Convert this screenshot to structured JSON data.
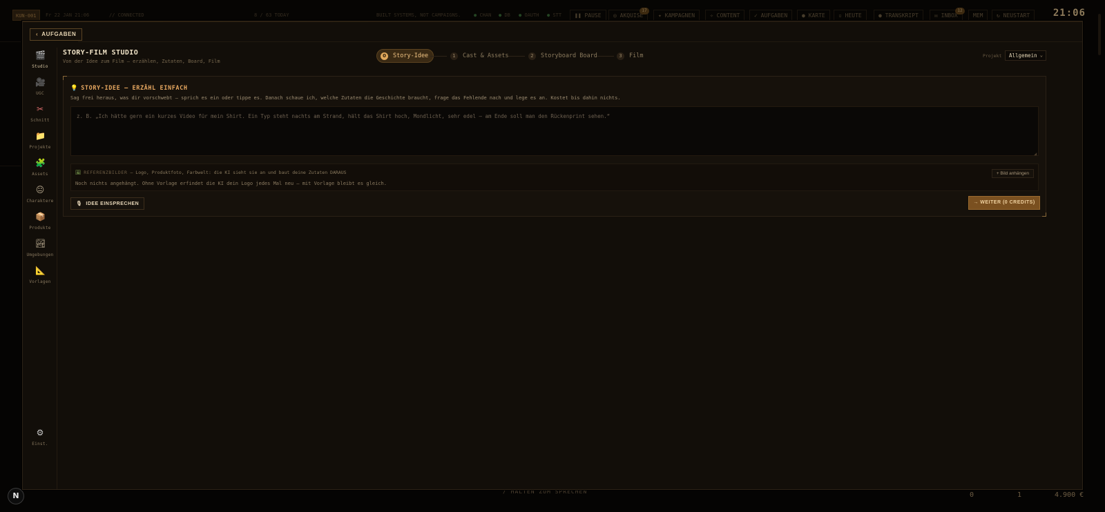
{
  "background": {
    "left_badge": "KUN-001",
    "topbar_left": "Fr 22 JAN 21:06",
    "topbar_connection": "// CONNECTED",
    "topbar_counter": "8 / 63 TODAY",
    "topbar_tagline": "BUILT SYSTEMS, NOT CAMPAIGNS.",
    "status_dots": [
      "CHAN",
      "DB",
      "OAUTH",
      "STT"
    ],
    "nav": [
      {
        "icon": "pause-icon",
        "glyph": "❚❚",
        "label": "PAUSE"
      },
      {
        "icon": "target-icon",
        "glyph": "◎",
        "label": "AKQUISE",
        "badge": "17"
      },
      {
        "icon": "spark-icon",
        "glyph": "✦",
        "label": "KAMPAGNEN"
      },
      {
        "icon": "diamond-icon",
        "glyph": "✧",
        "label": "CONTENT"
      },
      {
        "icon": "check-icon",
        "glyph": "✓",
        "label": "AUFGABEN"
      },
      {
        "icon": "globe-icon",
        "glyph": "●",
        "label": "KARTE"
      },
      {
        "icon": "calendar-icon",
        "glyph": "▫",
        "label": "HEUTE"
      },
      {
        "icon": "mic-icon",
        "glyph": "●",
        "label": "TRANSKRIPT"
      },
      {
        "icon": "mail-icon",
        "glyph": "✉",
        "label": "INBOX",
        "badge": "12"
      },
      {
        "icon": "memory-icon",
        "glyph": "",
        "label": "MEM"
      },
      {
        "icon": "restart-icon",
        "glyph": "↻",
        "label": "NEUSTART"
      }
    ],
    "clock": "21:06",
    "bottom_hint": "/ HALTEN ZUM SPRECHEN",
    "bottom_stats": [
      "0",
      "1",
      "4.900 €"
    ],
    "bottom_left_button": "N"
  },
  "modal": {
    "back_label": "AUFGABEN",
    "title": "STORY-FILM STUDIO",
    "subtitle": "Von der Idee zum Film — erzählen, Zutaten, Board, Film",
    "steps": [
      {
        "num": "0",
        "label": "Story-Idee",
        "active": true
      },
      {
        "num": "1",
        "label": "Cast & Assets",
        "active": false
      },
      {
        "num": "2",
        "label": "Storyboard Board",
        "active": false
      },
      {
        "num": "3",
        "label": "Film",
        "active": false
      }
    ],
    "project_label": "Projekt",
    "project_value": "Allgemein"
  },
  "sidebar": {
    "items": [
      {
        "icon": "clapperboard-icon",
        "glyph": "🎬",
        "label": "Studio",
        "active": true
      },
      {
        "icon": "film-camera-icon",
        "glyph": "🎥",
        "label": "UGC"
      },
      {
        "icon": "scissors-icon",
        "glyph": "✂",
        "label": "Schnitt"
      },
      {
        "icon": "folder-icon",
        "glyph": "📁",
        "label": "Projekte"
      },
      {
        "icon": "puzzle-icon",
        "glyph": "🧩",
        "label": "Assets"
      },
      {
        "icon": "face-icon",
        "glyph": "😐",
        "label": "Charaktere"
      },
      {
        "icon": "package-icon",
        "glyph": "📦",
        "label": "Produkte"
      },
      {
        "icon": "landscape-icon",
        "glyph": "🏞",
        "label": "Umgebungen"
      },
      {
        "icon": "ruler-triangle-icon",
        "glyph": "📐",
        "label": "Vorlagen"
      }
    ],
    "settings": {
      "icon": "gear-icon",
      "glyph": "⚙",
      "label": "Einst."
    }
  },
  "story": {
    "title_icon": "lightbulb-icon",
    "title_glyph": "💡",
    "title": "STORY-IDEE — ERZÄHL EINFACH",
    "description": "Sag frei heraus, was dir vorschwebt — sprich es ein oder tippe es. Danach schaue ich, welche Zutaten die Geschichte braucht, frage das Fehlende nach und lege es an. Kostet bis dahin nichts.",
    "input_value": "",
    "input_placeholder": "z. B. „Ich hätte gern ein kurzes Video für mein Shirt. Ein Typ steht nachts am Strand, hält das Shirt hoch, Mondlicht, sehr edel — am Ende soll man den Rückenprint sehen.“",
    "reference": {
      "icon": "image-icon",
      "glyph": "🖼",
      "heading": "REFERENZBILDER",
      "heading_detail": "— Logo, Produktfoto, Farbwelt: die KI sieht sie an und baut deine Zutaten DARAUS",
      "note": "Noch nichts angehängt. Ohne Vorlage erfindet die KI dein Logo jedes Mal neu — mit Vorlage bleibt es gleich.",
      "attach_label": "+ Bild anhängen"
    },
    "voice_label": "IDEE EINSPRECHEN",
    "voice_glyph": "🎙",
    "next_label": "→ WEITER (0 CREDITS)"
  },
  "colors": {
    "accent": "#e0a85c",
    "panel": "#120e09",
    "card": "#16110b",
    "primary_button": "#7a5020"
  }
}
